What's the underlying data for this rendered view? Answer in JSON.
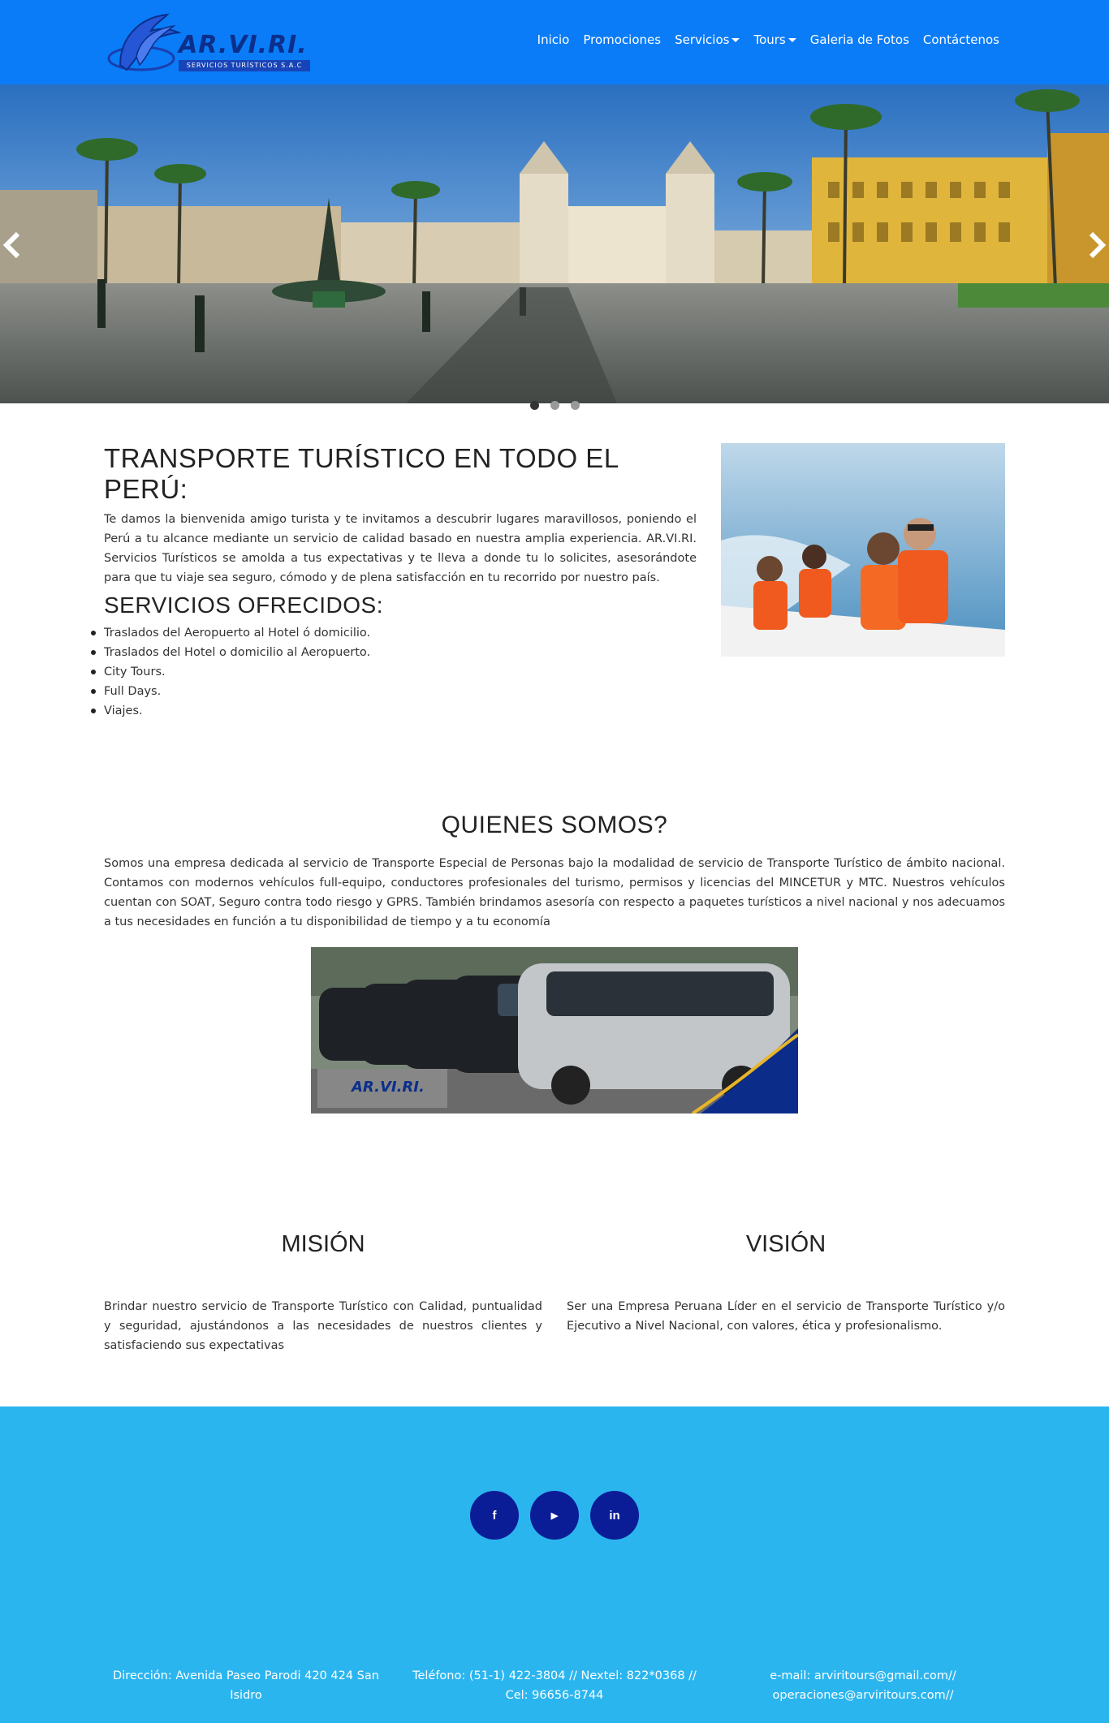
{
  "brand": {
    "name": "AR.VI.RI.",
    "tagline": "SERVICIOS TURÍSTICOS S.A.C"
  },
  "nav": {
    "items": [
      {
        "label": "Inicio"
      },
      {
        "label": "Promociones"
      },
      {
        "label": "Servicios",
        "dropdown": true
      },
      {
        "label": "Tours",
        "dropdown": true
      },
      {
        "label": "Galeria de Fotos"
      },
      {
        "label": "Contáctenos"
      }
    ]
  },
  "carousel": {
    "slides": 3,
    "active_index": 0
  },
  "intro": {
    "title": "TRANSPORTE TURÍSTICO EN TODO EL PERÚ:",
    "text": "Te damos la bienvenida amigo turista y te invitamos a descubrir lugares maravillosos, poniendo el Perú a tu alcance mediante un servicio de calidad basado en nuestra amplia experiencia. AR.VI.RI. Servicios Turísticos se amolda a tus expectativas y te lleva a donde tu lo solicites, asesorándote para que tu viaje sea seguro, cómodo y de plena satisfacción en tu recorrido por nuestro país."
  },
  "services": {
    "title": "SERVICIOS OFRECIDOS:",
    "items": [
      "Traslados del Aeropuerto al Hotel ó domicilio.",
      "Traslados del Hotel o domicilio al Aeropuerto.",
      "City Tours.",
      "Full Days.",
      "Viajes."
    ]
  },
  "about": {
    "title": "QUIENES SOMOS?",
    "text": "Somos una empresa dedicada al servicio de Transporte Especial de Personas bajo la modalidad de servicio de Transporte Turístico de ámbito nacional. Contamos con modernos vehículos full-equipo, conductores profesionales del turismo, permisos y licencias del MINCETUR y MTC. Nuestros vehículos cuentan con SOAT, Seguro contra todo riesgo y GPRS. También brindamos asesoría con respecto a paquetes turísticos a nivel nacional y nos adecuamos a tus necesidades en función a tu disponibilidad de tiempo y a tu economía"
  },
  "mision": {
    "title": "MISIÓN",
    "text": "Brindar nuestro servicio de Transporte Turístico con Calidad, puntualidad y seguridad, ajustándonos a las necesidades de nuestros clientes y satisfaciendo sus expectativas"
  },
  "vision": {
    "title": "VISIÓN",
    "text": "Ser una Empresa Peruana Líder en el servicio de Transporte Turístico y/o Ejecutivo a Nivel Nacional, con valores, ética y profesionalismo."
  },
  "footer": {
    "social": [
      {
        "icon": "facebook-icon",
        "glyph": "f"
      },
      {
        "icon": "youtube-icon",
        "glyph": "▶"
      },
      {
        "icon": "linkedin-icon",
        "glyph": "in"
      }
    ],
    "address": "Dirección: Avenida Paseo Parodi 420 424 San Isidro",
    "phone": "Teléfono: (51-1) 422-3804 // Nextel: 822*0368 // Cel: 96656-8744",
    "email": "e-mail: arviritours@gmail.com// operaciones@arviritours.com//"
  },
  "colors": {
    "navbar": "#0a7cf8",
    "footer": "#2bb5ef",
    "social_button": "#0b1d96"
  }
}
